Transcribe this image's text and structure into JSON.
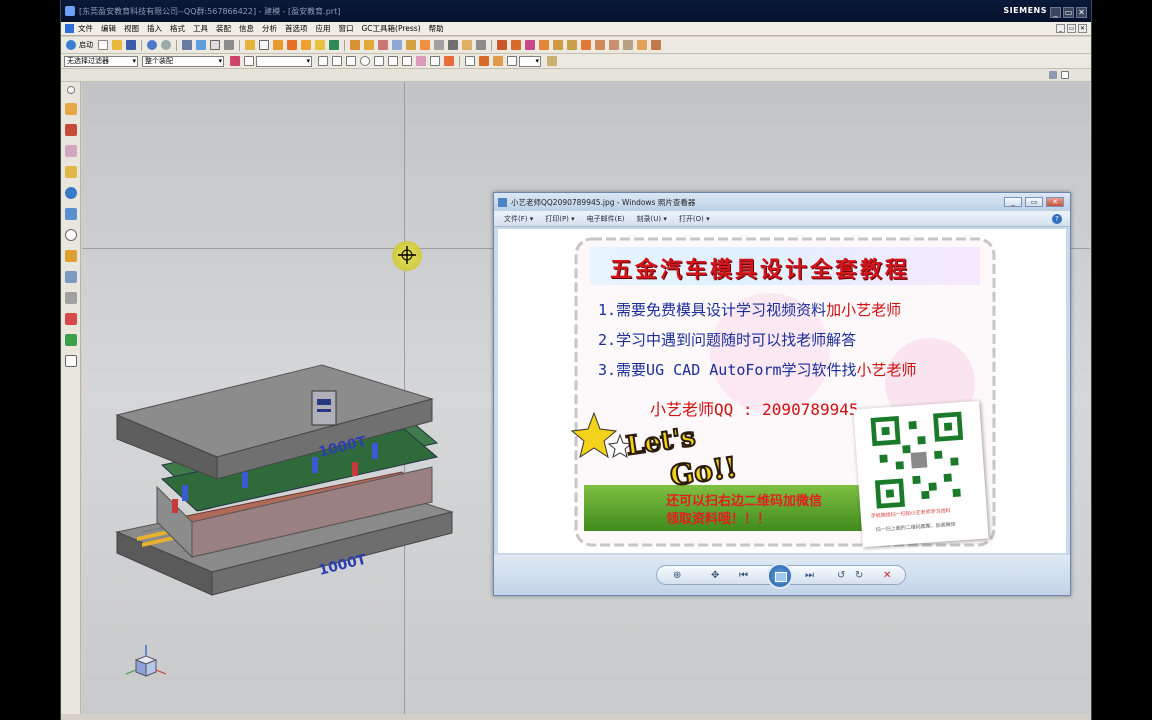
{
  "app": {
    "title": "[东莞盈安教育科技有限公司--QQ群:567866422] - 建模 - [盈安教育.prt]",
    "brand": "SIEMENS",
    "window_buttons": [
      "_",
      "▭",
      "✕"
    ]
  },
  "menu": {
    "items": [
      "文件",
      "编辑",
      "视图",
      "插入",
      "格式",
      "工具",
      "装配",
      "信息",
      "分析",
      "首选项",
      "应用",
      "窗口",
      "GC工具箱(Press)",
      "帮助"
    ]
  },
  "toolbar": {
    "start_label": "启动",
    "filter_combo": "无选择过滤器",
    "assembly_combo": "整个装配"
  },
  "mold_labels": {
    "top": "1000T",
    "bottom": "1000T"
  },
  "viewer": {
    "title": "小艺老师QQ2090789945.jpg - Windows 照片查看器",
    "menu": [
      "文件(F) ▾",
      "打印(P) ▾",
      "电子邮件(E)",
      "刻录(U) ▾",
      "打开(O) ▾"
    ],
    "help": "?",
    "poster": {
      "title": "五金汽车模具设计全套教程",
      "line1_a": "1.需要免费模具设计学习视频资料",
      "line1_b": "加小艺老师",
      "line2": "2.学习中遇到问题随时可以找老师解答",
      "line3_a": "3.需要UG CAD AutoForm学习软件找",
      "line3_b": "小艺老师",
      "qq": "小艺老师QQ : 2090789945",
      "letsgo_1": "Let's",
      "letsgo_2": "Go!!",
      "wechat_1": "还可以扫右边二维码加微信",
      "wechat_2": "领取资料哦！！！",
      "qr_caption": "手机微信扫一扫加小艺老师学习资料",
      "qr_caption2": "扫一扫上面的二维码图案，加我微信"
    }
  },
  "colors": {
    "title_bar": "#07102a",
    "viewport": "#cacbcc",
    "poster_red": "#cf1010",
    "poster_blue": "#1a2d9a"
  }
}
